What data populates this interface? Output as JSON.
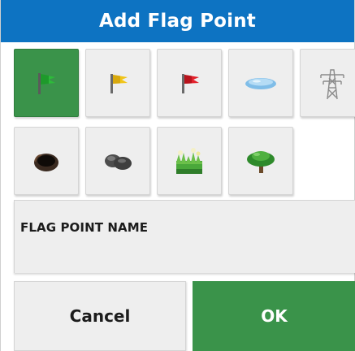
{
  "dialog": {
    "title": "Add Flag Point"
  },
  "colors": {
    "title_bar": "#0d73c2",
    "selected_tile": "#3a934a",
    "tile_background": "#eeeeee",
    "ok_button": "#3a934a"
  },
  "flag_types": {
    "selected": "green-flag",
    "items": [
      {
        "icon": "green-flag-icon"
      },
      {
        "icon": "yellow-flag-icon"
      },
      {
        "icon": "red-flag-icon"
      },
      {
        "icon": "water-icon"
      },
      {
        "icon": "power-pylon-icon"
      },
      {
        "icon": "hole-icon"
      },
      {
        "icon": "rocks-icon"
      },
      {
        "icon": "weeds-icon"
      },
      {
        "icon": "tree-icon"
      }
    ]
  },
  "name_field": {
    "label": "FLAG POINT NAME",
    "value": ""
  },
  "buttons": {
    "cancel_label": "Cancel",
    "ok_label": "OK"
  }
}
